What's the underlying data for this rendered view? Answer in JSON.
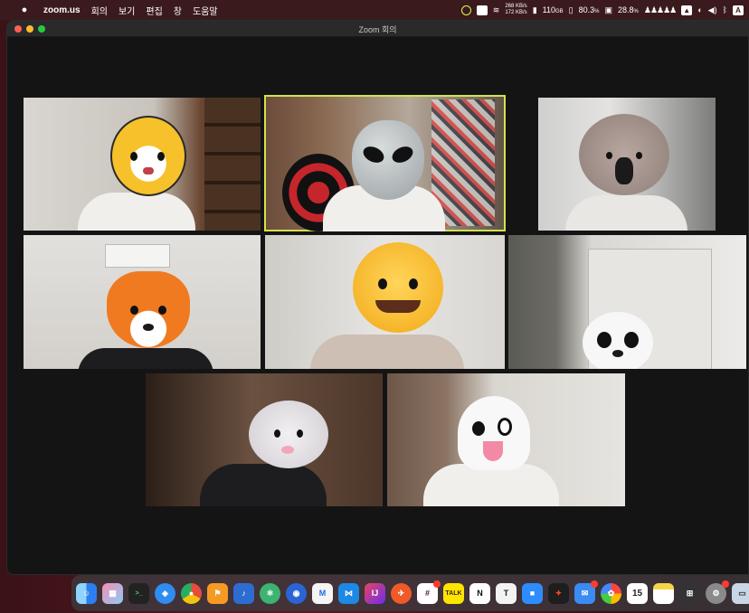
{
  "menubar": {
    "app_name": "zoom.us",
    "items": [
      "회의",
      "보기",
      "편집",
      "창",
      "도움말"
    ],
    "network_up": "268 KB/s",
    "network_down": "172 KB/s",
    "disk": "110",
    "disk_unit": "GB",
    "cpu_percent": "80.3",
    "cpu_unit": "%",
    "memory_percent": "28.8",
    "memory_unit": "%",
    "input_source": "A"
  },
  "window": {
    "title": "Zoom 회의"
  },
  "participants": [
    {
      "mask": "tiger-face"
    },
    {
      "mask": "alien-face"
    },
    {
      "mask": "koala-face"
    },
    {
      "mask": "fox-face"
    },
    {
      "mask": "cat-face"
    },
    {
      "mask": "panda-face"
    },
    {
      "mask": "mouse-face"
    },
    {
      "mask": "ghost-face"
    }
  ],
  "dock": {
    "calendar_day": "15",
    "kakaotalk_label": "TALK",
    "typora_label": "T",
    "notion_label": "N"
  },
  "colors": {
    "active_speaker_border": "#d4e24a",
    "window_bg": "#141414"
  }
}
